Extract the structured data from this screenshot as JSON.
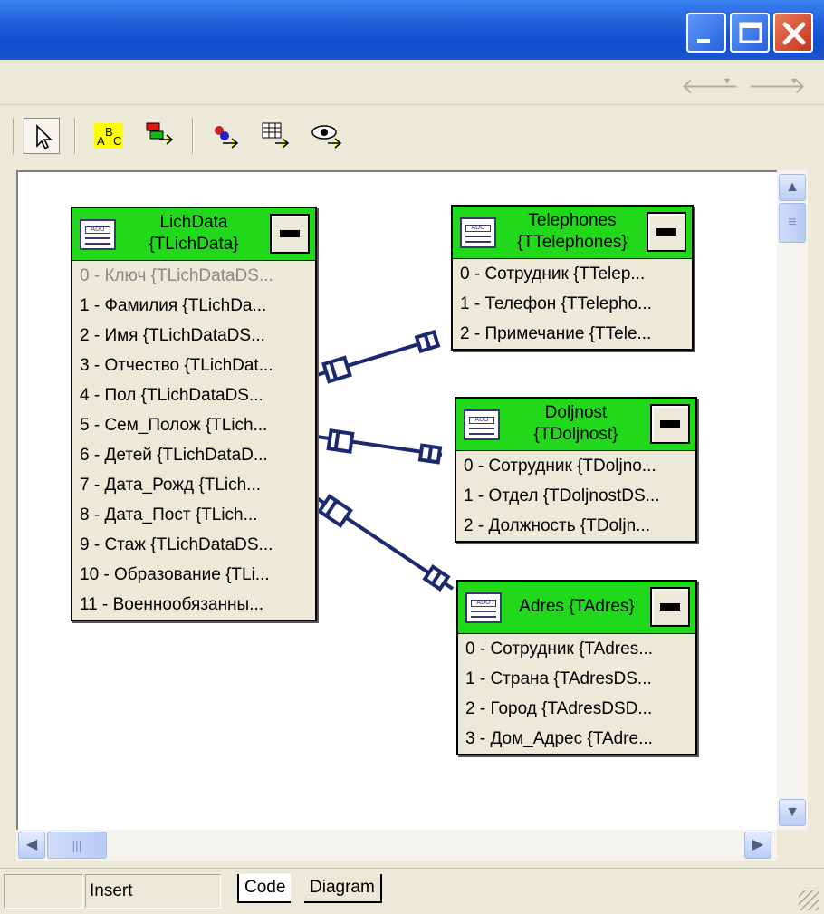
{
  "window": {
    "controls": [
      "minimize-icon",
      "maximize-icon",
      "close-icon"
    ]
  },
  "nav": {
    "back_icon": "back-arrow-icon",
    "forward_icon": "forward-arrow-icon"
  },
  "toolbar": {
    "tools": [
      "pointer-tool-icon",
      "abc-property-icon",
      "add-table-icon",
      "add-link-icon",
      "grid-icon",
      "view-eye-icon"
    ]
  },
  "tables": [
    {
      "title_line1": "LichData",
      "title_line2": "{TLichData}",
      "fields": [
        "0 - Ключ {TLichDataDS...",
        "1 - Фамилия {TLichDa...",
        "2 - Имя {TLichDataDS...",
        "3 - Отчество {TLichDat...",
        "4 - Пол {TLichDataDS...",
        "5 - Сем_Полож {TLich...",
        "6 - Детей {TLichDataD...",
        "7 - Дата_Рожд {TLich...",
        "8 - Дата_Пост {TLich...",
        "9 - Стаж {TLichDataDS...",
        "10 - Образование {TLi...",
        "11 - Военнообязанны..."
      ]
    },
    {
      "title_line1": "Telephones",
      "title_line2": "{TTelephones}",
      "fields": [
        "0 - Сотрудник {TTelep...",
        "1 - Телефон {TTelepho...",
        "2 - Примечание {TTele..."
      ]
    },
    {
      "title_line1": "Doljnost",
      "title_line2": "{TDoljnost}",
      "fields": [
        "0 - Сотрудник {TDoljno...",
        "1 - Отдел {TDoljnostDS...",
        "2 - Должность {TDoljn..."
      ]
    },
    {
      "title_line1": "Adres {TAdres}",
      "title_line2": "",
      "fields": [
        "0 - Сотрудник {TAdres...",
        "1 - Страна {TAdresDS...",
        "2 - Город {TAdresDSD...",
        "3 - Дом_Адрес {TAdre..."
      ]
    }
  ],
  "colors": {
    "header_green": "#22d81b",
    "link_navy": "#1b2a6e",
    "titlebar_blue": "#0c4fd0"
  },
  "statusbar": {
    "mode": "Insert",
    "tab_code": "Code",
    "tab_diagram": "Diagram"
  },
  "scroll": {
    "h_thumb_glyph": "|||",
    "v_thumb_glyph": "≡"
  }
}
